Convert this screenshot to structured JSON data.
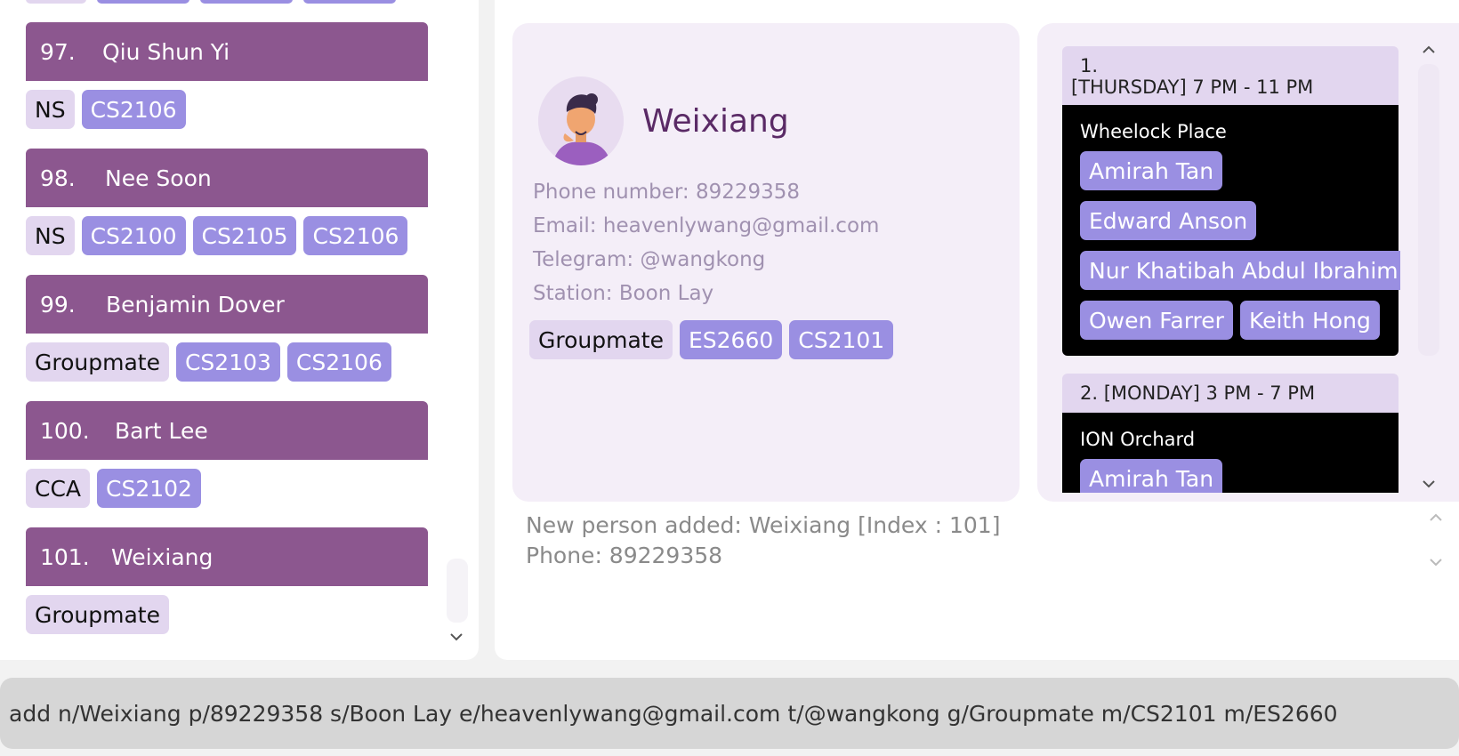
{
  "person_list": {
    "items": [
      {
        "index": "97.",
        "name": "Qiu Shun Yi",
        "role": "NS",
        "modules": [
          "CS2106"
        ]
      },
      {
        "index": "98.",
        "name": "Nee Soon",
        "role": "NS",
        "modules": [
          "CS2100",
          "CS2105",
          "CS2106"
        ]
      },
      {
        "index": "99.",
        "name": "Benjamin Dover",
        "role": "Groupmate",
        "modules": [
          "CS2103",
          "CS2106"
        ]
      },
      {
        "index": "100.",
        "name": "Bart Lee",
        "role": "CCA",
        "modules": [
          "CS2102"
        ]
      },
      {
        "index": "101.",
        "name": "Weixiang",
        "role": "Groupmate",
        "modules": []
      }
    ]
  },
  "detail": {
    "name": "Weixiang",
    "phone": "Phone number: 89229358",
    "email": "Email: heavenlywang@gmail.com",
    "telegram": "Telegram: @wangkong",
    "station": "Station: Boon Lay",
    "role": "Groupmate",
    "modules": [
      "ES2660",
      "CS2101"
    ]
  },
  "meetups": {
    "items": [
      {
        "header_line1": "1.",
        "header_line2": "[THURSDAY] 7 PM - 11 PM",
        "location": "Wheelock Place",
        "members": [
          "Amirah Tan",
          "Edward Anson",
          "Nur Khatibah Abdul Ibrahim",
          "Owen Farrer",
          "Keith Hong"
        ]
      },
      {
        "header_line1": "2. [MONDAY] 3 PM - 7 PM",
        "location": "ION Orchard",
        "members": [
          "Amirah Tan"
        ]
      }
    ]
  },
  "result": {
    "line1": "New person added: Weixiang [Index : 101]",
    "line2": "Phone: 89229358"
  },
  "command": {
    "value": "add n/Weixiang p/89229358 s/Boon Lay e/heavenlywang@gmail.com t/@wangkong g/Groupmate m/CS2101 m/ES2660"
  },
  "colors": {
    "person_header": "#8c578f",
    "role_tag": "#e2d6ef",
    "module_tag": "#9a8fe2",
    "card_bg": "#f4eef8",
    "name_text": "#5a2a66"
  }
}
